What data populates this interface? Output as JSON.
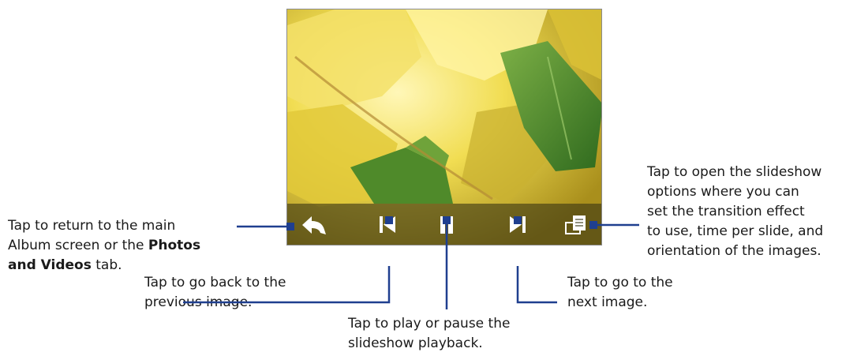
{
  "callouts": {
    "return": {
      "line1": "Tap to return to the main",
      "line2_pre": "Album screen or the ",
      "line2_bold": "Photos",
      "line3_bold": "and Videos",
      "line3_post": " tab."
    },
    "previous": {
      "line1": "Tap to go back to the",
      "line2": "previous image."
    },
    "next": {
      "line1": "Tap to go to the",
      "line2": "next image."
    },
    "play_pause": {
      "line1": "Tap to play or pause the",
      "line2": "slideshow playback."
    },
    "options": {
      "line1": "Tap to open the slideshow",
      "line2": "options where you can",
      "line3": "set the transition effect",
      "line4": "to use, time per slide, and",
      "line5": "orientation of the images."
    }
  },
  "toolbar": {
    "buttons": [
      {
        "id": "back",
        "icon": "return-arrow-icon"
      },
      {
        "id": "previous",
        "icon": "skip-previous-icon"
      },
      {
        "id": "pause",
        "icon": "pause-icon"
      },
      {
        "id": "next",
        "icon": "skip-next-icon"
      },
      {
        "id": "options",
        "icon": "slideshow-options-icon"
      }
    ]
  },
  "colors": {
    "leader": "#1f3f8f",
    "toolbar_icon": "#ffffff",
    "photo_leaf_yellow": "#e8d23a",
    "photo_leaf_green": "#4f8a2a"
  }
}
